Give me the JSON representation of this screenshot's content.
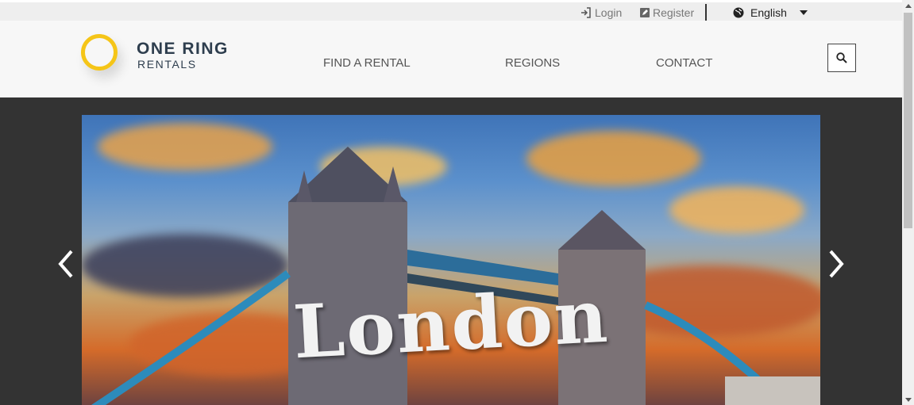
{
  "topbar": {
    "login": "Login",
    "register": "Register",
    "language": "English"
  },
  "logo": {
    "name": "ONE RING",
    "sub": "RENTALS"
  },
  "nav": {
    "items": [
      "FIND A RENTAL",
      "REGIONS",
      "CONTACT"
    ]
  },
  "hero": {
    "slide_title": "London"
  },
  "colors": {
    "accent": "#f5c518",
    "brand_text": "#2e3e4e",
    "hero_bg": "#333333"
  },
  "icons": {
    "login": "login-icon",
    "register": "edit-icon",
    "language": "globe-icon",
    "search": "search-icon",
    "prev": "chevron-left-icon",
    "next": "chevron-right-icon"
  }
}
